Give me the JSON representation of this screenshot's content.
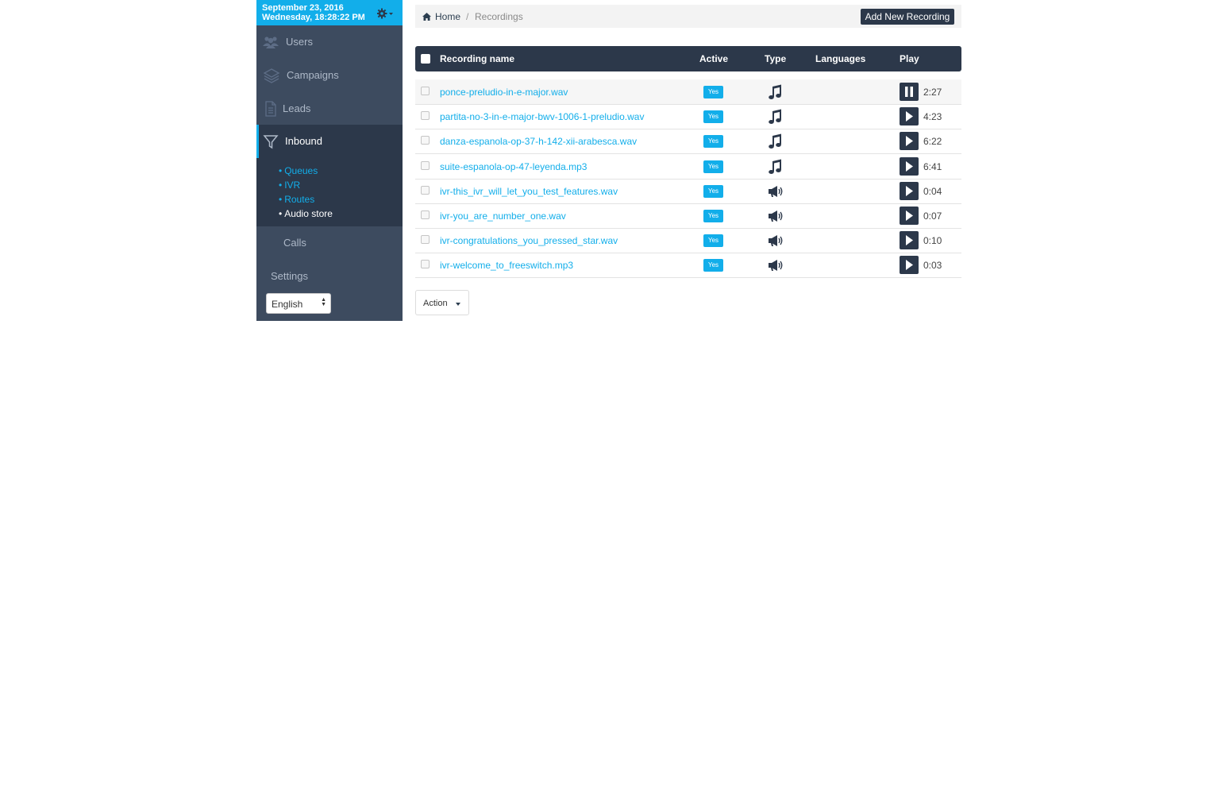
{
  "clock": {
    "date": "September 23, 2016",
    "time": "Wednesday, 18:28:22 PM"
  },
  "sidebar": {
    "items": [
      {
        "label": "Users",
        "icon": "users-icon"
      },
      {
        "label": "Campaigns",
        "icon": "layers-icon"
      },
      {
        "label": "Leads",
        "icon": "document-icon"
      },
      {
        "label": "Inbound",
        "icon": "funnel-icon"
      },
      {
        "label": "Calls"
      },
      {
        "label": "Settings"
      }
    ],
    "inbound_sub": [
      "Queues",
      "IVR",
      "Routes",
      "Audio store"
    ],
    "language": "English"
  },
  "breadcrumb": {
    "home": "Home",
    "separator": "/",
    "current": "Recordings"
  },
  "add_button": "Add New Recording",
  "table": {
    "headers": {
      "name": "Recording name",
      "active": "Active",
      "type": "Type",
      "languages": "Languages",
      "play": "Play"
    },
    "rows": [
      {
        "name": "ponce-preludio-in-e-major.wav",
        "active": "Yes",
        "type": "music-icon",
        "playing": true,
        "duration": "2:27"
      },
      {
        "name": "partita-no-3-in-e-major-bwv-1006-1-preludio.wav",
        "active": "Yes",
        "type": "music-icon",
        "playing": false,
        "duration": "4:23"
      },
      {
        "name": "danza-espanola-op-37-h-142-xii-arabesca.wav",
        "active": "Yes",
        "type": "music-icon",
        "playing": false,
        "duration": "6:22"
      },
      {
        "name": "suite-espanola-op-47-leyenda.mp3",
        "active": "Yes",
        "type": "music-icon",
        "playing": false,
        "duration": "6:41"
      },
      {
        "name": "ivr-this_ivr_will_let_you_test_features.wav",
        "active": "Yes",
        "type": "megaphone-icon",
        "playing": false,
        "duration": "0:04"
      },
      {
        "name": "ivr-you_are_number_one.wav",
        "active": "Yes",
        "type": "megaphone-icon",
        "playing": false,
        "duration": "0:07"
      },
      {
        "name": "ivr-congratulations_you_pressed_star.wav",
        "active": "Yes",
        "type": "megaphone-icon",
        "playing": false,
        "duration": "0:10"
      },
      {
        "name": "ivr-welcome_to_freeswitch.mp3",
        "active": "Yes",
        "type": "megaphone-icon",
        "playing": false,
        "duration": "0:03"
      }
    ]
  },
  "action_button": "Action",
  "colors": {
    "accent": "#12aeea",
    "sidebar": "#3d4b5f",
    "dark": "#2c384a"
  }
}
